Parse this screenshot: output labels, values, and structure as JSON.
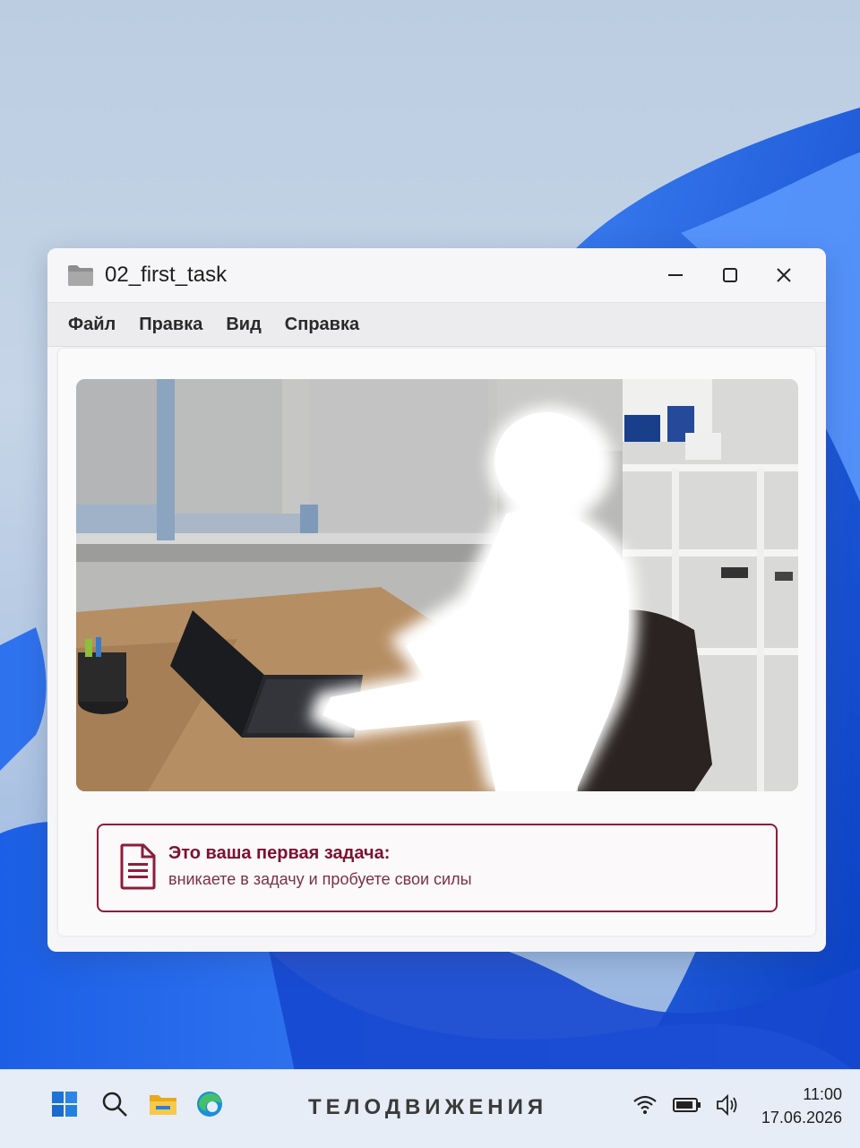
{
  "window": {
    "title": "02_first_task",
    "icon": "folder-icon",
    "controls": {
      "minimize": "minimize-icon",
      "maximize": "maximize-icon",
      "close": "close-icon"
    }
  },
  "menu": {
    "items": [
      "Файл",
      "Правка",
      "Вид",
      "Справка"
    ]
  },
  "task": {
    "icon": "document-icon",
    "title": "Это ваша первая задача:",
    "subtitle": "вникаете в задачу и пробуете свои силы"
  },
  "taskbar": {
    "brand": "ТЕЛОДВИЖЕНИЯ",
    "time": "11:00",
    "date": "17.06.2026",
    "icons": [
      "windows-start-icon",
      "search-icon",
      "file-explorer-icon",
      "edge-browser-icon",
      "wifi-icon",
      "battery-icon",
      "volume-icon"
    ]
  },
  "colors": {
    "accent": "#8c1d3a",
    "window_bg": "#f6f6f8",
    "taskbar_bg": "#e7edf6"
  }
}
